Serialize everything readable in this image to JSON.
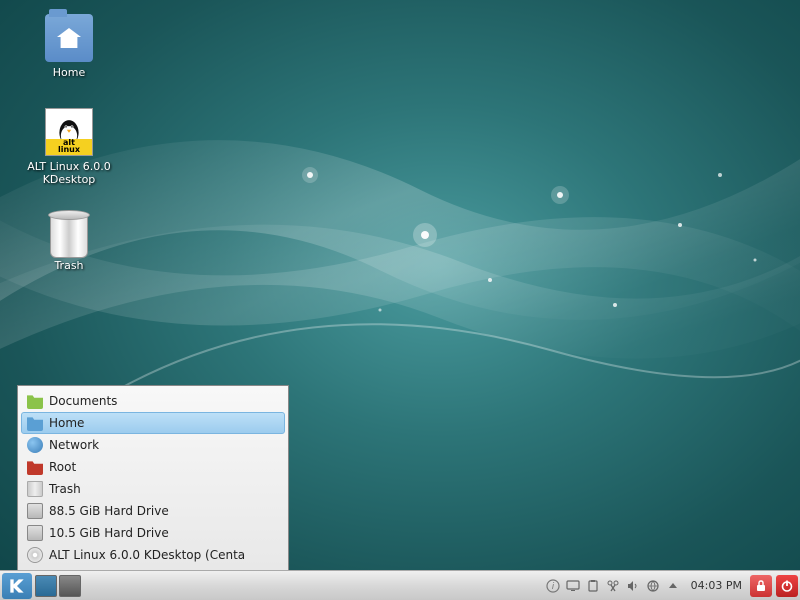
{
  "desktop_icons": {
    "home": "Home",
    "altlinux": "ALT Linux 6.0.0 KDesktop",
    "trash": "Trash"
  },
  "places_menu": [
    {
      "label": "Documents",
      "icon": "folder-green"
    },
    {
      "label": "Home",
      "icon": "folder-blue",
      "selected": true
    },
    {
      "label": "Network",
      "icon": "globe"
    },
    {
      "label": "Root",
      "icon": "folder-red"
    },
    {
      "label": "Trash",
      "icon": "trash"
    },
    {
      "label": "88.5 GiB Hard Drive",
      "icon": "drive"
    },
    {
      "label": "10.5 GiB Hard Drive",
      "icon": "drive"
    },
    {
      "label": "ALT Linux 6.0.0 KDesktop  (Centa",
      "icon": "disc"
    }
  ],
  "panel": {
    "clock": "04:03 PM"
  },
  "colors": {
    "folder_green": "#8bc34a",
    "folder_blue": "#5a9fd4",
    "folder_red": "#c0392b",
    "globe": "#4a90d9"
  }
}
